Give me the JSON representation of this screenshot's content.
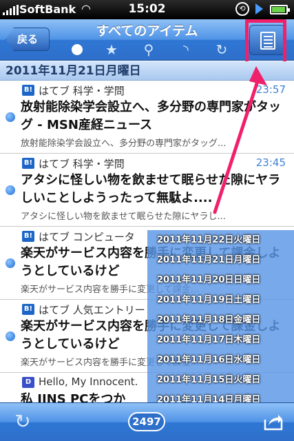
{
  "status_bar": {
    "carrier": "SoftBank",
    "time": "15:02"
  },
  "nav": {
    "back_label": "戻る",
    "title": "すべてのアイテム",
    "filter_icons": [
      "dot-icon",
      "star-icon",
      "search-icon",
      "rss-icon",
      "reload-icon"
    ],
    "doc_button_icon": "document-list-icon"
  },
  "date_header": "2011年11月21日月曜日",
  "items": [
    {
      "badge": "B!",
      "source": "はてブ 科学・学問",
      "time": "23:57",
      "title": "放射能除染学会設立へ、多分野の専門家がタッグ - MSN産経ニュース",
      "snippet": "放射能除染学会設立へ、多分野の専門家がタッグ..."
    },
    {
      "badge": "B!",
      "source": "はてブ 科学・学問",
      "time": "23:45",
      "title": "アタシに怪しい物を飲ませて眠らせた隙にヤラしいことしようったって無駄よ....",
      "snippet": "アタシに怪しい物を飲ませて眠らせた隙にヤラし..."
    },
    {
      "badge": "B!",
      "source": "はてブ コンピュータ",
      "time": "",
      "title": "楽天がサービス内容を勝手に変更して課金しようとしているけど",
      "snippet": "楽天がサービス内容を勝手に変更して課金..."
    },
    {
      "badge": "B!",
      "source": "はてブ 人気エントリー",
      "time": "",
      "title": "楽天がサービス内容を勝手に変更して課金しようとしているけど",
      "snippet": "楽天がサービス内容を勝手に変更して課金..."
    },
    {
      "badge": "D",
      "source": "Hello, My Innocent.",
      "time": "",
      "title": "私 JINS PCをつか",
      "snippet": ""
    }
  ],
  "date_options": [
    "2011年11月22日火曜日",
    "2011年11月21日月曜日",
    "2011年11月20日日曜日",
    "2011年11月19日土曜日",
    "2011年11月18日金曜日",
    "2011年11月17日木曜日",
    "2011年11月16日水曜日",
    "2011年11月15日火曜日",
    "2011年11月14日月曜日"
  ],
  "toolbar": {
    "unread_count": "2497"
  },
  "colors": {
    "nav_blue": "#2e6fca",
    "highlight_pink": "#f0206a",
    "time_blue": "#3c80d6"
  }
}
